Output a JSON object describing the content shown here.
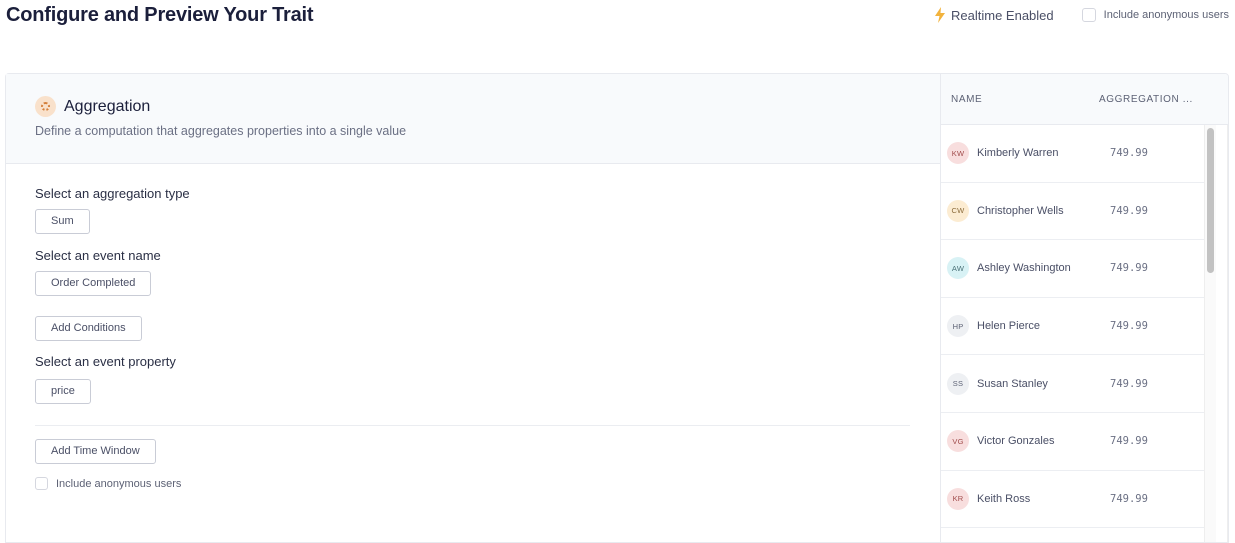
{
  "page": {
    "title": "Configure and Preview Your Trait",
    "realtime_label": "Realtime Enabled",
    "include_anonymous_label": "Include anonymous users",
    "include_anonymous_checked": false
  },
  "config": {
    "section_title": "Aggregation",
    "section_subtitle": "Define a computation that aggregates properties into a single value",
    "icon": "aggregation-icon",
    "aggregation_type_label": "Select an aggregation type",
    "aggregation_type_value": "Sum",
    "event_name_label": "Select an event name",
    "event_name_value": "Order Completed",
    "add_conditions_label": "Add Conditions",
    "event_property_label": "Select an event property",
    "event_property_value": "price",
    "add_time_window_label": "Add Time Window",
    "include_anonymous_label": "Include anonymous users",
    "include_anonymous_checked": false
  },
  "preview": {
    "columns": [
      "NAME",
      "AGGREGATION ..."
    ],
    "rows": [
      {
        "initials": "KW",
        "name": "Kimberly Warren",
        "value": "749.99",
        "avatar_bg": "#f8dede",
        "avatar_fg": "#a14c4c"
      },
      {
        "initials": "CW",
        "name": "Christopher Wells",
        "value": "749.99",
        "avatar_bg": "#fcecd2",
        "avatar_fg": "#8a6a3a"
      },
      {
        "initials": "AW",
        "name": "Ashley Washington",
        "value": "749.99",
        "avatar_bg": "#d8f2f5",
        "avatar_fg": "#4a7278"
      },
      {
        "initials": "HP",
        "name": "Helen Pierce",
        "value": "749.99",
        "avatar_bg": "#eef0f3",
        "avatar_fg": "#5d6275"
      },
      {
        "initials": "SS",
        "name": "Susan Stanley",
        "value": "749.99",
        "avatar_bg": "#eef0f3",
        "avatar_fg": "#5d6275"
      },
      {
        "initials": "VG",
        "name": "Victor Gonzales",
        "value": "749.99",
        "avatar_bg": "#f8dede",
        "avatar_fg": "#a14c4c"
      },
      {
        "initials": "KR",
        "name": "Keith Ross",
        "value": "749.99",
        "avatar_bg": "#f8dede",
        "avatar_fg": "#a14c4c"
      }
    ]
  }
}
